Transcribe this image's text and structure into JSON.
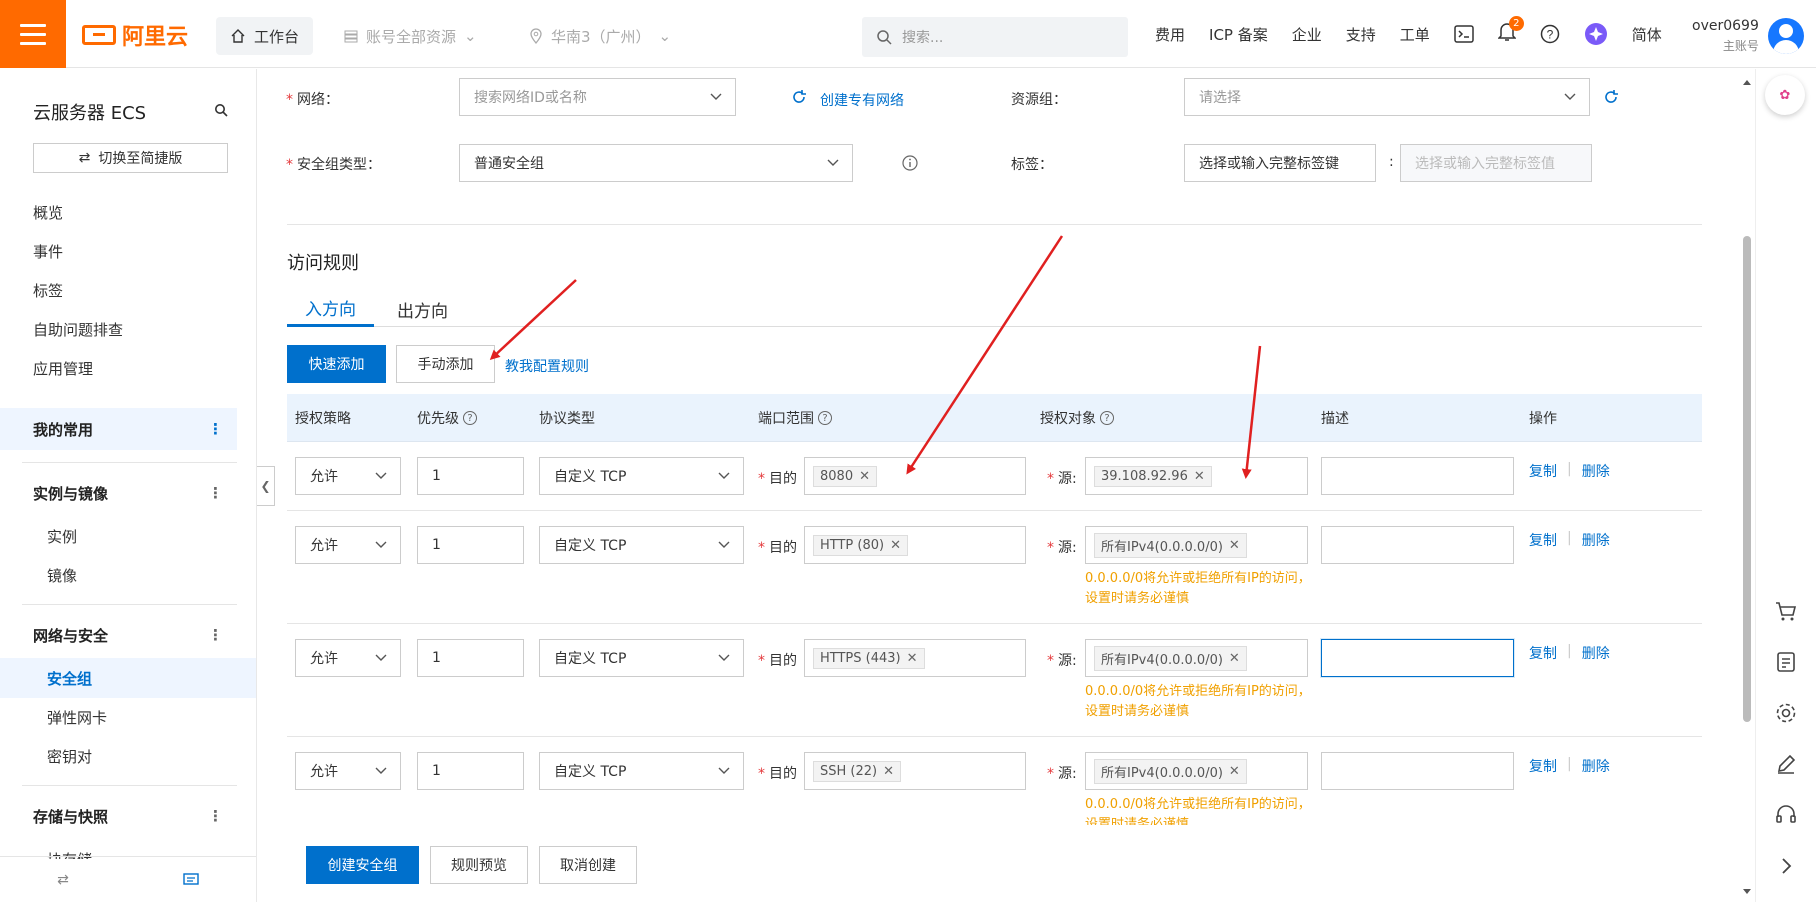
{
  "topbar": {
    "logo_text": "阿里云",
    "workbench": "工作台",
    "account_scope": "账号全部资源",
    "region": "华南3（广州）",
    "search_placeholder": "搜索...",
    "links": [
      "费用",
      "ICP 备案",
      "企业",
      "支持",
      "工单"
    ],
    "bell_count": "2",
    "lang": "简体",
    "username": "over0699",
    "account_type": "主账号"
  },
  "sidebar": {
    "title": "云服务器 ECS",
    "switch_label": "切换至简捷版",
    "items": [
      "概览",
      "事件",
      "标签",
      "自助问题排查",
      "应用管理"
    ],
    "groups": {
      "favorites": "我的常用",
      "instances": "实例与镜像",
      "network": "网络与安全",
      "storage": "存储与快照"
    },
    "instance_items": [
      "实例",
      "镜像"
    ],
    "network_items": [
      "安全组",
      "弹性网卡",
      "密钥对"
    ],
    "storage_items": [
      "块存储"
    ]
  },
  "form": {
    "network_label": "网络：",
    "network_placeholder": "搜索网络ID或名称",
    "create_vpc_link": "创建专有网络",
    "resource_group_label": "资源组：",
    "resource_group_placeholder": "请选择",
    "sg_type_label": "安全组类型：",
    "sg_type_value": "普通安全组",
    "tags_label": "标签：",
    "tag_key_placeholder": "选择或输入完整标签键",
    "tag_value_placeholder": "选择或输入完整标签值",
    "colon": ":"
  },
  "rules": {
    "section_title": "访问规则",
    "tab_inbound": "入方向",
    "tab_outbound": "出方向",
    "quick_add": "快速添加",
    "manual_add": "手动添加",
    "teach_link": "教我配置规则",
    "headers": {
      "policy": "授权策略",
      "priority": "优先级",
      "protocol": "协议类型",
      "port": "端口范围",
      "target": "授权对象",
      "desc": "描述",
      "action": "操作"
    },
    "dest_prefix": "目的",
    "src_prefix": "源:",
    "copy": "复制",
    "delete": "删除",
    "warning": "0.0.0.0/0将允许或拒绝所有IP的访问，设置时请务必谨慎",
    "rows": [
      {
        "policy": "允许",
        "priority": "1",
        "protocol": "自定义 TCP",
        "port": "8080",
        "source": "39.108.92.96",
        "desc": ""
      },
      {
        "policy": "允许",
        "priority": "1",
        "protocol": "自定义 TCP",
        "port": "HTTP (80)",
        "source": "所有IPv4(0.0.0.0/0)",
        "desc": ""
      },
      {
        "policy": "允许",
        "priority": "1",
        "protocol": "自定义 TCP",
        "port": "HTTPS (443)",
        "source": "所有IPv4(0.0.0.0/0)",
        "desc": ""
      },
      {
        "policy": "允许",
        "priority": "1",
        "protocol": "自定义 TCP",
        "port": "SSH (22)",
        "source": "所有IPv4(0.0.0.0/0)",
        "desc": ""
      }
    ]
  },
  "footer": {
    "create": "创建安全组",
    "preview": "规则预览",
    "cancel": "取消创建"
  },
  "colors": {
    "brand": "#ff6a00",
    "primary": "#0070cc",
    "warning": "#f0a000",
    "annotation": "#e02020"
  }
}
